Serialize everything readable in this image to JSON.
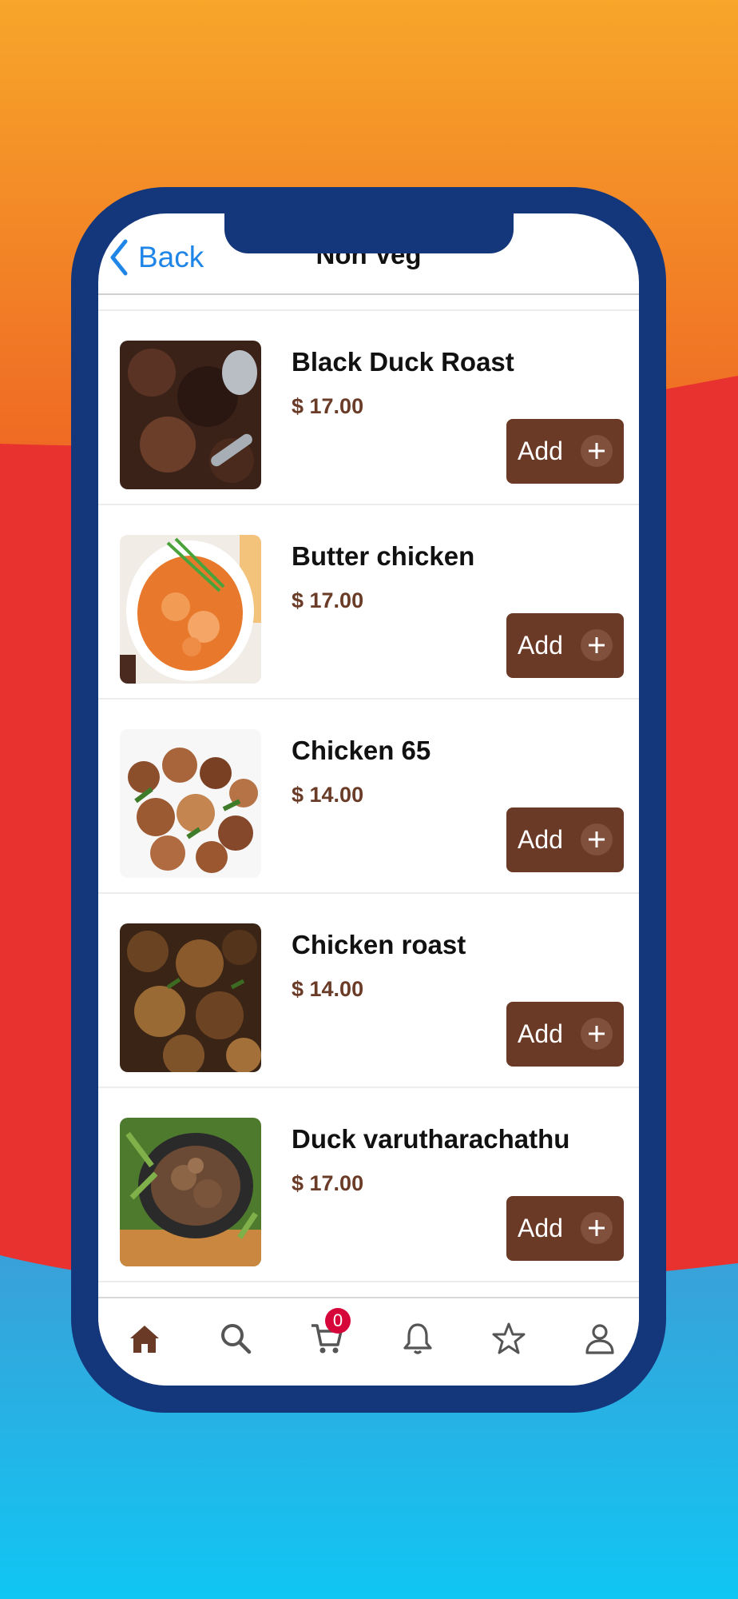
{
  "colors": {
    "brand_brown": "#6b3a26",
    "back_blue": "#1f86e8",
    "phone_frame": "#14377c",
    "badge_red": "#d6063a"
  },
  "nav": {
    "back_label": "Back",
    "title": "Non Veg"
  },
  "items": [
    {
      "name": "Black Duck Roast",
      "price": "$ 17.00",
      "add_label": "Add",
      "image": "black-duck-roast"
    },
    {
      "name": "Butter chicken",
      "price": "$ 17.00",
      "add_label": "Add",
      "image": "butter-chicken"
    },
    {
      "name": "Chicken 65",
      "price": "$ 14.00",
      "add_label": "Add",
      "image": "chicken-65"
    },
    {
      "name": "Chicken roast",
      "price": "$ 14.00",
      "add_label": "Add",
      "image": "chicken-roast"
    },
    {
      "name": "Duck varutharachathu",
      "price": "$ 17.00",
      "add_label": "Add",
      "image": "duck-varutharachathu"
    }
  ],
  "tabbar": {
    "cart_count": "0",
    "tabs": [
      "home-icon",
      "search-icon",
      "cart-icon",
      "bell-icon",
      "star-icon",
      "profile-icon"
    ]
  }
}
